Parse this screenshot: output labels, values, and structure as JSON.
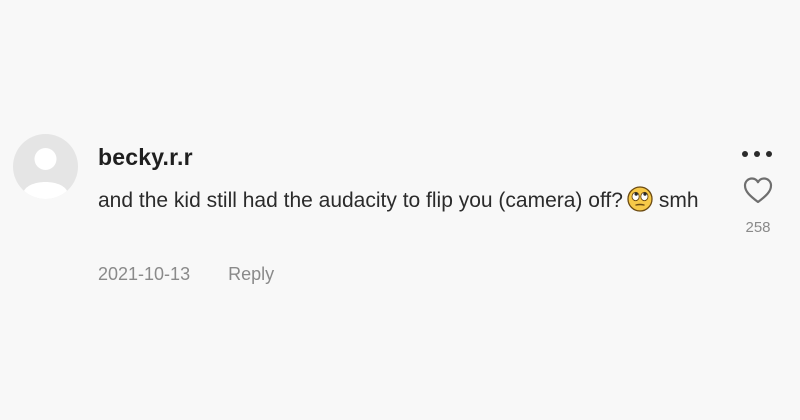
{
  "comment": {
    "username": "becky.r.r",
    "text_before_emoji": "and the kid still had the audacity to flip you (camera) off?",
    "emoji_icon": "face-with-rolling-eyes-icon",
    "text_after_emoji": "smh",
    "date": "2021-10-13",
    "reply_label": "Reply",
    "like_count": "258",
    "more_icon": "more-options-icon",
    "like_icon": "heart-outline-icon"
  },
  "colors": {
    "background": "#f8f8f8",
    "username": "#1f1f1f",
    "text": "#2b2b2b",
    "muted": "#8a8a8a",
    "avatar_bg": "#e5e5e5",
    "avatar_fg": "#ffffff",
    "emoji_face": "#f7c948"
  }
}
